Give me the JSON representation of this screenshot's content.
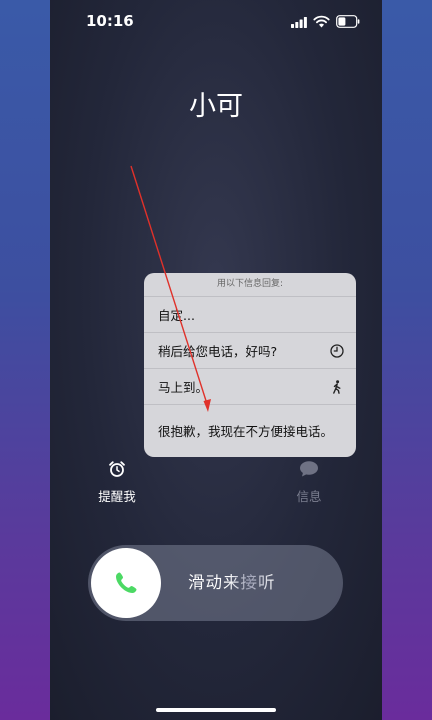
{
  "status_bar": {
    "time": "10:16"
  },
  "call": {
    "caller_name": "小可"
  },
  "reply_sheet": {
    "header": "用以下信息回复:",
    "options": [
      {
        "label": "自定...",
        "icon": ""
      },
      {
        "label": "稍后给您电话，好吗?",
        "icon": "clock-icon"
      },
      {
        "label": "马上到。",
        "icon": "walking-person-icon"
      },
      {
        "label": "很抱歉，我现在不方便接电话。",
        "icon": ""
      }
    ]
  },
  "actions": {
    "remind_label": "提醒我",
    "remind_icon": "alarm-clock-icon",
    "message_label": "信息",
    "message_icon": "message-bubble-icon"
  },
  "slider": {
    "label": "滑动来接听",
    "icon": "phone-icon",
    "knob_color": "#4cd964"
  },
  "annotation": {
    "color": "#e0312a"
  }
}
